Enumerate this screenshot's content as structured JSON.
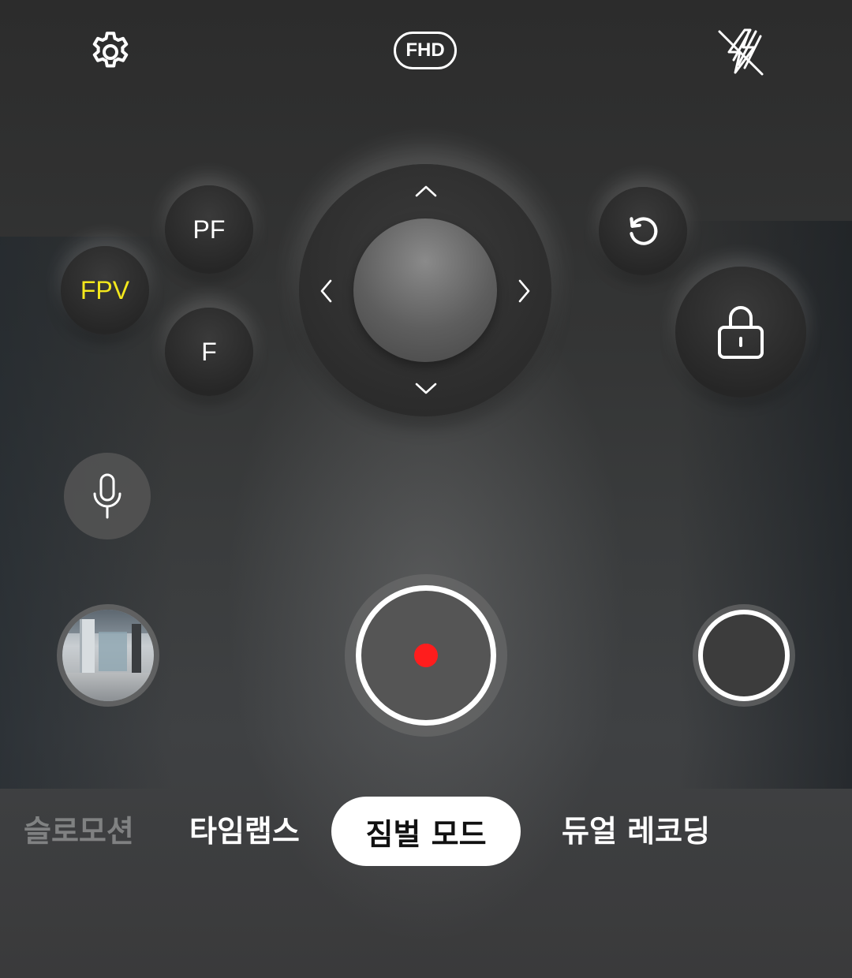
{
  "top_bar": {
    "settings_icon": "gear-icon",
    "resolution_label": "FHD",
    "flash_icon": "flash-off-icon"
  },
  "gimbal": {
    "preset_buttons": {
      "fpv": "FPV",
      "pf": "PF",
      "f": "F"
    },
    "active_preset": "FPV",
    "active_color": "#f4e81c",
    "joystick_icons": [
      "chevron-up-icon",
      "chevron-down-icon",
      "chevron-left-icon",
      "chevron-right-icon"
    ],
    "reset_icon": "rotate-ccw-icon",
    "lock_icon": "lock-icon"
  },
  "controls": {
    "mic_icon": "microphone-icon",
    "gallery": "gallery-thumbnail",
    "record_color": "#ff1d1d"
  },
  "modes": {
    "items": [
      "슬로모션",
      "타임랩스",
      "짐벌 모드",
      "듀얼 레코딩"
    ],
    "active": "짐벌 모드"
  }
}
